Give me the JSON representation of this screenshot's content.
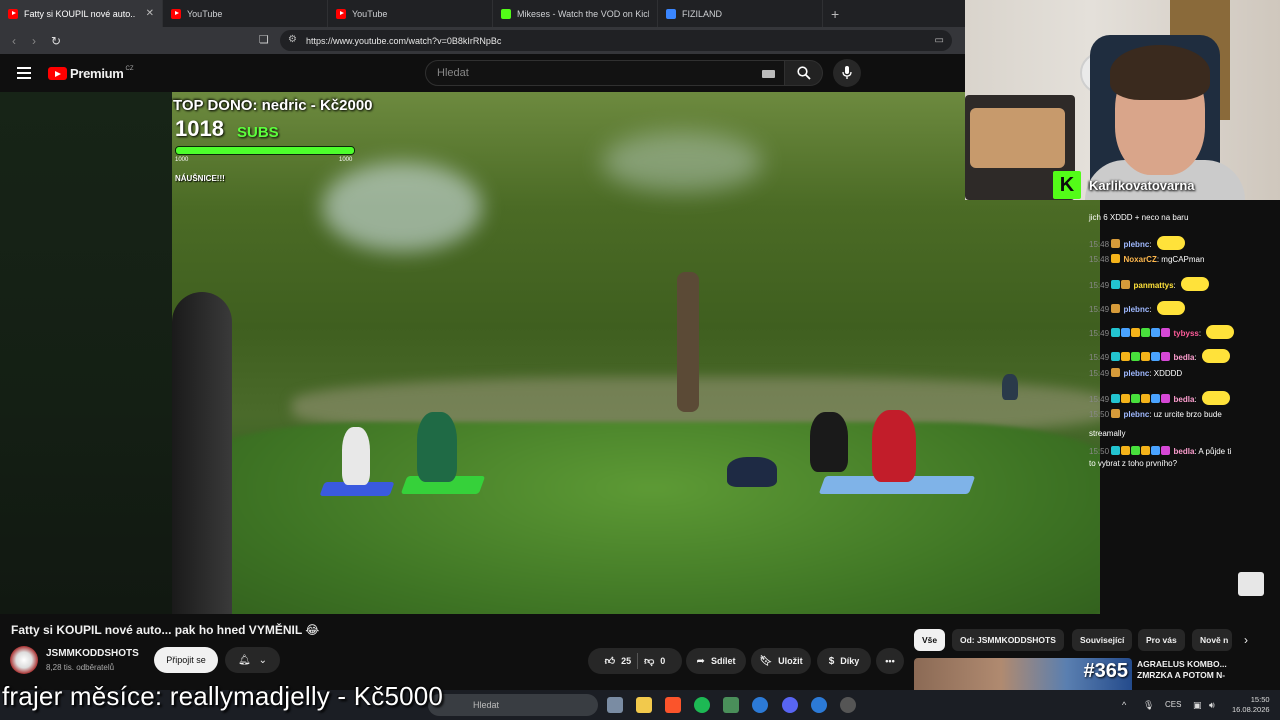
{
  "browser": {
    "tabs": [
      {
        "label": "Fatty si KOUPIL nové auto... pak",
        "icon": "youtube-icon",
        "active": true
      },
      {
        "label": "YouTube",
        "icon": "youtube-icon"
      },
      {
        "label": "YouTube",
        "icon": "youtube-icon"
      },
      {
        "label": "Mikeses - Watch the VOD on Kick",
        "icon": "kick-icon"
      },
      {
        "label": "FIZILAND",
        "icon": "fiziland-icon"
      }
    ],
    "url": "https://www.youtube.com/watch?v=0B8kIrRNpBc"
  },
  "youtube": {
    "logo_text": "Premium",
    "logo_region": "CZ",
    "search_placeholder": "Hledat",
    "video_title": "Fatty si KOUPIL nové auto... pak ho hned VYMĚNIL 😂",
    "channel": {
      "name": "JSMMKODDSHOTS",
      "subscribers": "8,28 tis. odběratelů"
    },
    "join_label": "Připojit se",
    "actions": {
      "likes": "25",
      "dislikes": "0",
      "share": "Sdílet",
      "save": "Uložit",
      "thanks": "Díky"
    },
    "chips": [
      {
        "label": "Vše",
        "selected": true
      },
      {
        "label": "Od: JSMMKODDSHOTS"
      },
      {
        "label": "Související"
      },
      {
        "label": "Pro vás"
      },
      {
        "label": "Nově n"
      }
    ],
    "recommendation": {
      "number": "#365",
      "title_line1": "AGRAELUS KOMBO...",
      "title_line2": "ZMRZKA A POTOM N-"
    }
  },
  "stream_overlay": {
    "top_dono": "TOP DONO: nedric - Kč2000",
    "sub_count": "1018",
    "sub_label": "SUBS",
    "bar_min": "1000",
    "bar_max": "1000",
    "goal_text": "NÁUŠNICE!!!",
    "webcam_name": "Karlikovatovarna",
    "kick_letter": "K",
    "banner": "frajer měsíce: reallymadjelly - Kč5000"
  },
  "chat": {
    "messages": [
      {
        "time": "",
        "user": "",
        "text": "jich 6 XDDD + neco na baru",
        "user_color": "#ffffff"
      },
      {
        "time": "15:48",
        "user": "plebnc",
        "text": "",
        "user_color": "#9fb9ff",
        "emote": true
      },
      {
        "time": "15:48",
        "user": "NoxarCZ",
        "text": "mgCAPman",
        "user_color": "#ffb84d"
      },
      {
        "time": "15:49",
        "user": "panmattys",
        "text": "",
        "user_color": "#ffe23a",
        "emote": true
      },
      {
        "time": "15:49",
        "user": "plebnc",
        "text": "",
        "user_color": "#9fb9ff",
        "emote": true
      },
      {
        "time": "15:49",
        "user": "tybyss",
        "text": "",
        "user_color": "#ff5c9a",
        "emote": true
      },
      {
        "time": "15:49",
        "user": "bedla",
        "text": "",
        "user_color": "#ff9fd0",
        "emote": true
      },
      {
        "time": "15:49",
        "user": "plebnc",
        "text": "XDDDD",
        "user_color": "#9fb9ff"
      },
      {
        "time": "15:49",
        "user": "bedla",
        "text": "",
        "user_color": "#ff9fd0",
        "emote": true
      },
      {
        "time": "15:50",
        "user": "plebnc",
        "text": "uz urcite brzo bude",
        "user_color": "#9fb9ff"
      },
      {
        "time": "",
        "user": "",
        "text": "streamally",
        "user_color": "#ffffff"
      },
      {
        "time": "15:50",
        "user": "bedla",
        "text": "A půjde ti",
        "user_color": "#ff9fd0"
      },
      {
        "time": "",
        "user": "",
        "text": "to vybrat z toho prvního?",
        "user_color": "#ffffff"
      }
    ]
  },
  "taskbar": {
    "search_placeholder": "Hledat",
    "lang": "CES",
    "time": "15:50",
    "date": "16.08.2026"
  },
  "colors": {
    "yt_red": "#ff0000",
    "kick_green": "#53fc18",
    "sub_bar_green": "#4dff2c"
  },
  "sub_progress": 1.0
}
